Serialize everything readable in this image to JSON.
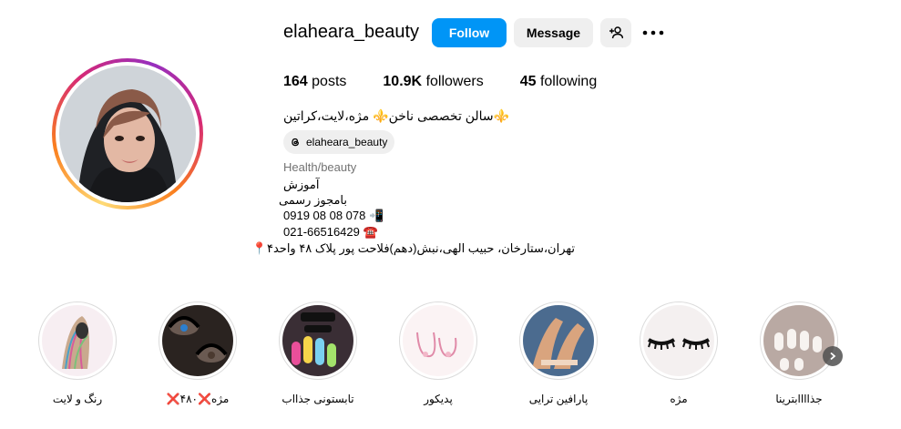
{
  "profile": {
    "username": "elaheara_beauty",
    "follow_label": "Follow",
    "message_label": "Message",
    "stats": {
      "posts_count": "164",
      "posts_label": "posts",
      "followers_count": "10.9K",
      "followers_label": "followers",
      "following_count": "45",
      "following_label": "following"
    },
    "bio": {
      "line1": "⚜️سالن تخصصی ناخن⚜️ مژه،لایت،کراتین",
      "threads_handle": "elaheara_beauty",
      "category": "Health/beauty",
      "line_education": "آموزش",
      "line_license": "بامجوز رسمی",
      "phone_mobile": "0919 08 08 078 📲",
      "phone_landline": "021-66516429 ☎️",
      "address": "تهران،ستارخان، حبیب الهی،نبش(دهم)فلاحت پور پلاک ۴۸ واحد۴📍"
    }
  },
  "highlights": [
    {
      "label": "رنگ و لایت"
    },
    {
      "label": "مژه❌۴۸۰❌"
    },
    {
      "label": "تابستونی جذااب"
    },
    {
      "label": "پدیکور"
    },
    {
      "label": "پارافین ترایی"
    },
    {
      "label": "مژه"
    },
    {
      "label": "جذاااابترینا"
    }
  ],
  "icons": {
    "suggest": "person-plus-icon",
    "more": "more-horizontal-icon",
    "threads": "threads-icon",
    "next": "chevron-right-icon"
  },
  "colors": {
    "follow_blue": "#0095f6",
    "button_gray": "#efefef",
    "secondary_text": "#737373"
  }
}
